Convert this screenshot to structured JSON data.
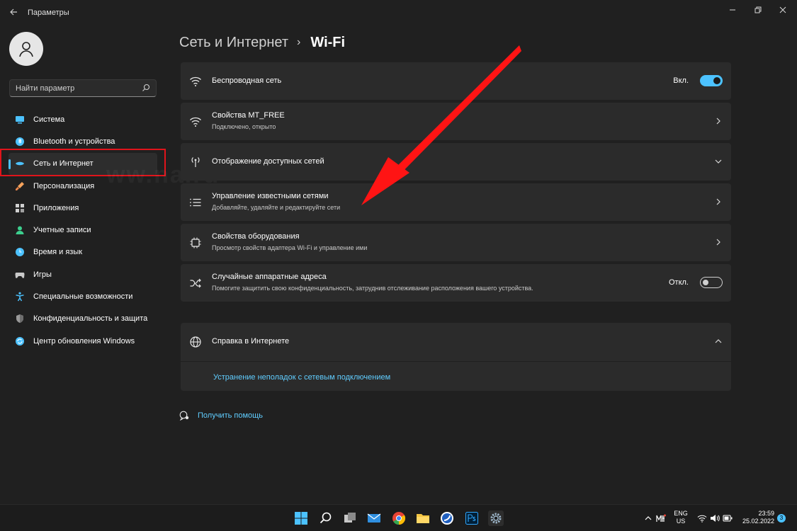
{
  "window": {
    "app_title": "Параметры"
  },
  "sidebar": {
    "search_placeholder": "Найти параметр",
    "items": [
      {
        "label": "Система",
        "icon": "monitor-icon",
        "color": "#4cc2ff"
      },
      {
        "label": "Bluetooth и устройства",
        "icon": "bluetooth-icon",
        "color": "#4cc2ff"
      },
      {
        "label": "Сеть и Интернет",
        "icon": "network-icon",
        "color": "#4cc2ff",
        "active": true
      },
      {
        "label": "Персонализация",
        "icon": "brush-icon",
        "color": "#f7a35c"
      },
      {
        "label": "Приложения",
        "icon": "apps-icon",
        "color": "#d0d0d0"
      },
      {
        "label": "Учетные записи",
        "icon": "user-icon",
        "color": "#3ccf8e"
      },
      {
        "label": "Время и язык",
        "icon": "globe-clock-icon",
        "color": "#4cc2ff"
      },
      {
        "label": "Игры",
        "icon": "gamepad-icon",
        "color": "#d0d0d0"
      },
      {
        "label": "Специальные возможности",
        "icon": "accessibility-icon",
        "color": "#4cc2ff"
      },
      {
        "label": "Конфиденциальность и защита",
        "icon": "shield-icon",
        "color": "#9a9a9a"
      },
      {
        "label": "Центр обновления Windows",
        "icon": "update-icon",
        "color": "#4cc2ff"
      }
    ]
  },
  "breadcrumb": {
    "parent": "Сеть и Интернет",
    "separator": "›",
    "current": "Wi-Fi"
  },
  "settings": {
    "wireless": {
      "title": "Беспроводная сеть",
      "toggle_label": "Вкл.",
      "on": true
    },
    "properties": {
      "title": "Свойства MT_FREE",
      "subtitle": "Подключено, открыто"
    },
    "available": {
      "title": "Отображение доступных сетей"
    },
    "manage": {
      "title": "Управление известными сетями",
      "subtitle": "Добавляйте, удаляйте и редактируйте сети"
    },
    "hardware": {
      "title": "Свойства оборудования",
      "subtitle": "Просмотр свойств адаптера Wi-Fi и управление ими"
    },
    "random_mac": {
      "title": "Случайные аппаратные адреса",
      "subtitle": "Помогите защитить свою конфиденциальность, затруднив отслеживание расположения вашего устройства.",
      "toggle_label": "Откл.",
      "on": false
    }
  },
  "help": {
    "title": "Справка в Интернете",
    "link": "Устранение неполадок с сетевым подключением",
    "get_help": "Получить помощь"
  },
  "taskbar": {
    "lang_top": "ENG",
    "lang_bottom": "US",
    "time": "23:59",
    "date": "25.02.2022",
    "notification_count": "3"
  },
  "colors": {
    "accent": "#4cc2ff",
    "annotation": "#e0141b"
  }
}
